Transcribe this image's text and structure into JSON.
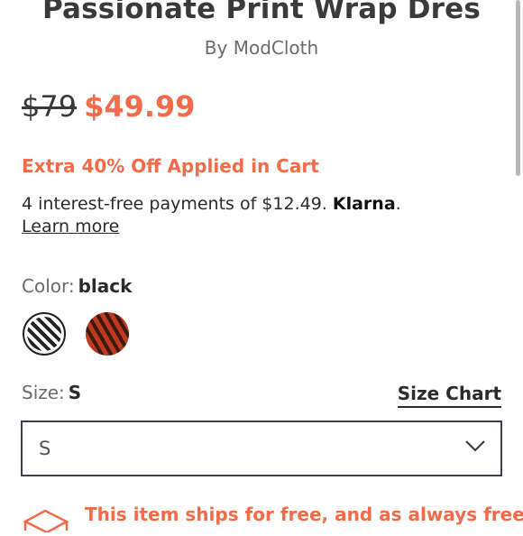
{
  "product": {
    "title": "Passionate Print Wrap Dres",
    "byline": "By ModCloth",
    "original_price": "$79",
    "sale_price": "$49.99",
    "promo": "Extra 40% Off Applied in Cart"
  },
  "klarna": {
    "text": "4 interest-free payments of $12.49.",
    "brand": "Klarna",
    "period": ".",
    "learn_more": "Learn more"
  },
  "color": {
    "label": "Color:",
    "selected": "black",
    "swatches": [
      "black",
      "red"
    ]
  },
  "size": {
    "label": "Size:",
    "selected": "S",
    "chart_link": "Size Chart",
    "dropdown_value": "S"
  },
  "shipping": {
    "text": "This item ships for free, and as always free"
  },
  "colors": {
    "accent": "#f26b4a",
    "text": "#2b2b2b",
    "muted": "#6b6b6b"
  }
}
